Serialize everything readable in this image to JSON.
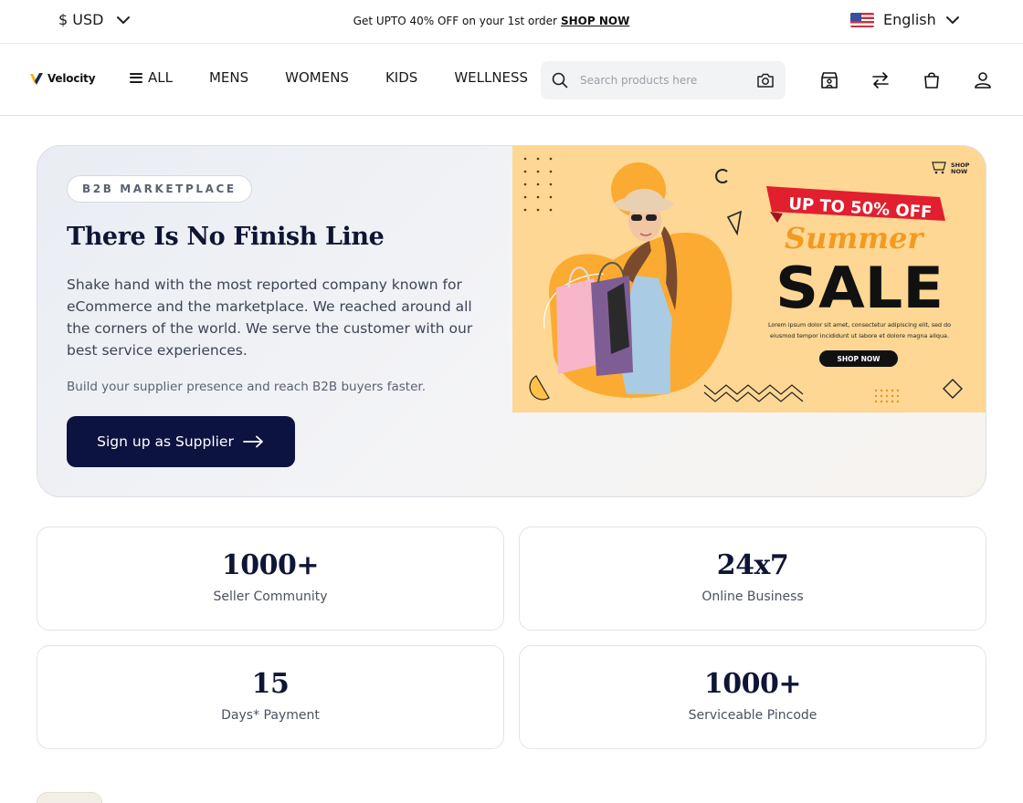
{
  "topbar": {
    "currency": "$ USD",
    "announcement": "Get UPTO 40% OFF on your 1st order",
    "announcement_link": "SHOP NOW",
    "language": "English"
  },
  "navbar": {
    "logo_text": "Velocity",
    "menu": [
      {
        "label": "ALL"
      },
      {
        "label": "MENS"
      },
      {
        "label": "WOMENS"
      },
      {
        "label": "KIDS"
      },
      {
        "label": "WELLNESS"
      }
    ],
    "search_placeholder": "Search products here",
    "icons": [
      "store-icon",
      "compare-icon",
      "cart-icon",
      "user-icon"
    ]
  },
  "hero": {
    "badge": "B2B MARKETPLACE",
    "title": "There Is No Finish Line",
    "description": "Shake hand with the most reported company known for eCommerce and the marketplace. We reached around all the corners of the world. We serve the customer with our best service experiences.",
    "subtext": "Build your supplier presence and reach B2B buyers faster.",
    "cta": "Sign up as Supplier"
  },
  "banner": {
    "shop_now_top": [
      "SHOP",
      "NOW"
    ],
    "ribbon": "UP TO 50% OFF",
    "script_word": "Summer",
    "headline": "SALE",
    "body_lines": [
      "Lorem ipsum dolor sit amet, consectetur adipiscing elit, sed do",
      "eiusmod tempor incididunt ut labore et dolore magna aliqua."
    ],
    "button": "SHOP NOW",
    "colors": {
      "background": "#fdd793",
      "accent": "#fba92a",
      "ribbon": "#e11f2f",
      "dark": "#111111"
    }
  },
  "stats": [
    {
      "value": "1000+",
      "label": "Seller Community"
    },
    {
      "value": "24x7",
      "label": "Online Business"
    },
    {
      "value": "15",
      "label": "Days* Payment"
    },
    {
      "value": "1000+",
      "label": "Serviceable Pincode"
    }
  ],
  "colors": {
    "primary": "#0d1340",
    "text": "#0f1535",
    "muted": "#5a6270"
  }
}
